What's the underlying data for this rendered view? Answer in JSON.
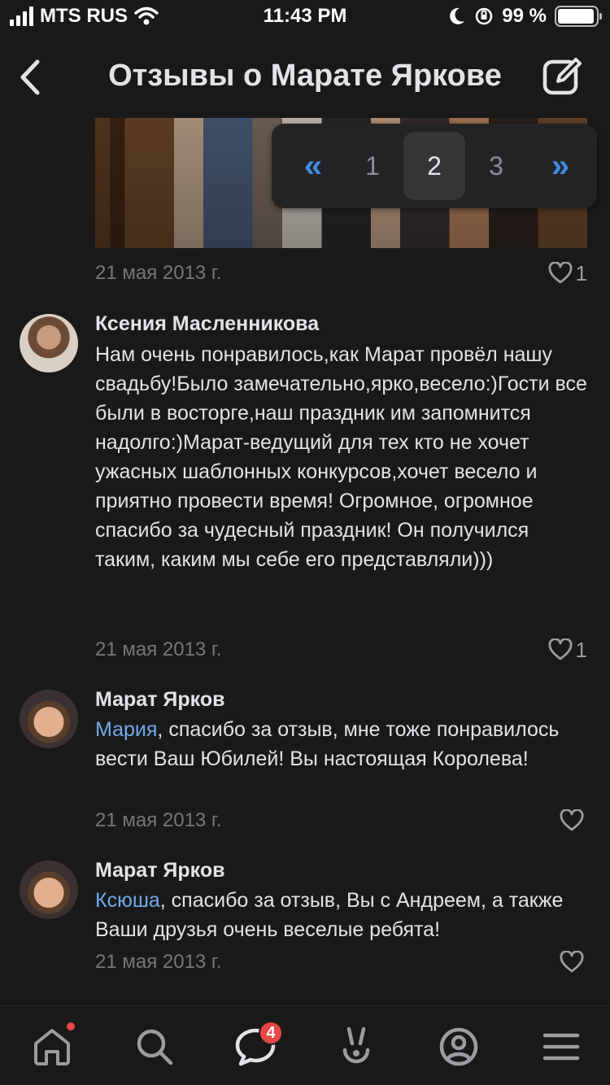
{
  "status": {
    "carrier": "MTS RUS",
    "time": "11:43 PM",
    "battery": "99 %"
  },
  "header": {
    "title": "Отзывы о Марате Яркове",
    "back_icon": "chevron-left-icon",
    "action_icon": "compose-icon"
  },
  "pager": {
    "prev": "«",
    "pages": [
      "1",
      "2",
      "3"
    ],
    "active": "2",
    "next": "»"
  },
  "photo_post": {
    "date": "21 мая 2013 г.",
    "likes": "1"
  },
  "comments": [
    {
      "author": "Ксения Масленникова",
      "text": "Нам очень понравилось,как Марат провёл нашу свадьбу!Было замечательно,ярко,весело:)Гости все были в восторге,наш праздник им запомнится надолго:)Марат-ведущий для тех кто не хочет ужасных шаблонных конкурсов,хочет весело и приятно провести время! Огромное, огромное спасибо за чудесный праздник! Он получился таким, каким мы себе его представляли)))",
      "date": "21 мая 2013 г.",
      "likes": "1"
    },
    {
      "author": "Марат Ярков",
      "mention": "Мария",
      "text": ", спасибо за отзыв, мне тоже понравилось вести Ваш Юбилей! Вы настоящая Королева!",
      "date": "21 мая 2013 г.",
      "likes": ""
    },
    {
      "author": "Марат Ярков",
      "mention": "Ксюша",
      "text": ", спасибо за отзыв, Вы с Андреем, а также Ваши друзья очень веселые ребята!",
      "date": "21 мая 2013 г.",
      "likes": ""
    }
  ],
  "tabbar": {
    "items": [
      "home-icon",
      "search-icon",
      "messages-icon",
      "clips-icon",
      "profile-icon",
      "menu-icon"
    ],
    "messages_badge": "4"
  },
  "colors": {
    "accent": "#3f8ae0",
    "mention": "#71aaeb",
    "badge": "#e64646",
    "background": "#19191a"
  }
}
